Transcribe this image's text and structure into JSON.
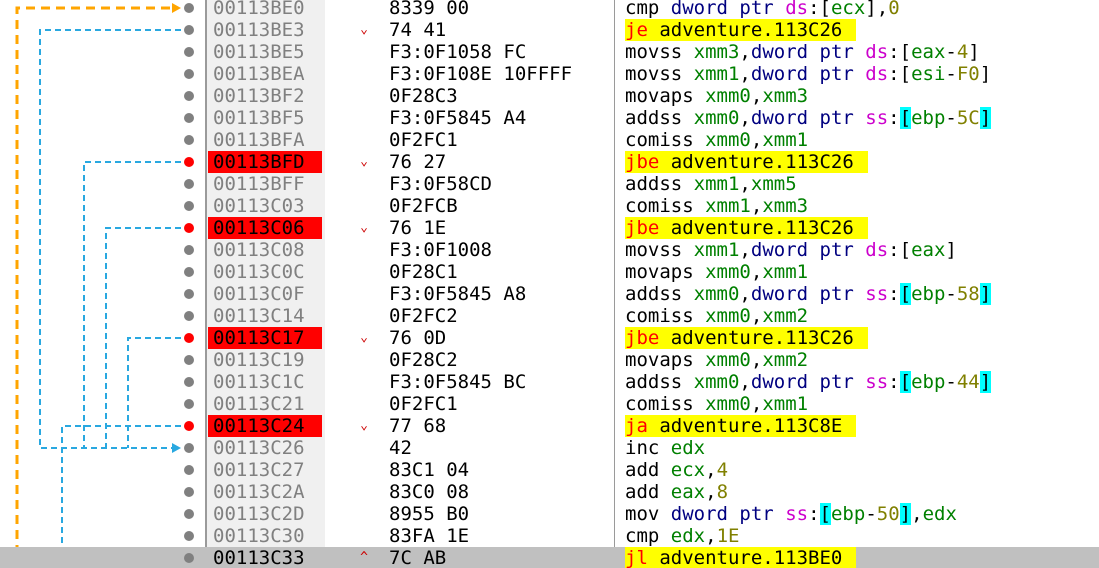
{
  "rows": [
    {
      "addr": "00113BE0",
      "bytes": "8339 00",
      "arrow": "",
      "bp": false,
      "jump": false,
      "tok": [
        [
          "m",
          "cmp"
        ],
        [
          "p",
          " "
        ],
        [
          "k",
          "dword ptr"
        ],
        [
          "p",
          " "
        ],
        [
          "seg",
          "ds"
        ],
        [
          "p",
          ":["
        ],
        [
          "r",
          "ecx"
        ],
        [
          "p",
          "],"
        ],
        [
          "num",
          "0"
        ]
      ]
    },
    {
      "addr": "00113BE3",
      "bytes": "74 41",
      "arrow": "⌄",
      "bp": false,
      "jump": true,
      "tok": [
        [
          "mj",
          "je"
        ],
        [
          "p",
          " "
        ],
        [
          "m",
          "adventure.113C26"
        ]
      ]
    },
    {
      "addr": "00113BE5",
      "bytes": "F3:0F1058 FC",
      "arrow": "",
      "bp": false,
      "jump": false,
      "tok": [
        [
          "m",
          "movss"
        ],
        [
          "p",
          " "
        ],
        [
          "r",
          "xmm3"
        ],
        [
          "p",
          ","
        ],
        [
          "k",
          "dword ptr"
        ],
        [
          "p",
          " "
        ],
        [
          "seg",
          "ds"
        ],
        [
          "p",
          ":["
        ],
        [
          "r",
          "eax"
        ],
        [
          "p",
          "-"
        ],
        [
          "num",
          "4"
        ],
        [
          "p",
          "]"
        ]
      ]
    },
    {
      "addr": "00113BEA",
      "bytes": "F3:0F108E 10FFFF",
      "arrow": "",
      "bp": false,
      "jump": false,
      "tok": [
        [
          "m",
          "movss"
        ],
        [
          "p",
          " "
        ],
        [
          "r",
          "xmm1"
        ],
        [
          "p",
          ","
        ],
        [
          "k",
          "dword ptr"
        ],
        [
          "p",
          " "
        ],
        [
          "seg",
          "ds"
        ],
        [
          "p",
          ":["
        ],
        [
          "r",
          "esi"
        ],
        [
          "p",
          "-"
        ],
        [
          "num",
          "F0"
        ],
        [
          "p",
          "]"
        ]
      ]
    },
    {
      "addr": "00113BF2",
      "bytes": "0F28C3",
      "arrow": "",
      "bp": false,
      "jump": false,
      "tok": [
        [
          "m",
          "movaps"
        ],
        [
          "p",
          " "
        ],
        [
          "r",
          "xmm0"
        ],
        [
          "p",
          ","
        ],
        [
          "r",
          "xmm3"
        ]
      ]
    },
    {
      "addr": "00113BF5",
      "bytes": "F3:0F5845 A4",
      "arrow": "",
      "bp": false,
      "jump": false,
      "tok": [
        [
          "m",
          "addss"
        ],
        [
          "p",
          " "
        ],
        [
          "r",
          "xmm0"
        ],
        [
          "p",
          ","
        ],
        [
          "k",
          "dword ptr"
        ],
        [
          "p",
          " "
        ],
        [
          "seg",
          "ss"
        ],
        [
          "p",
          ":"
        ],
        [
          "bk",
          "["
        ],
        [
          "r",
          "ebp"
        ],
        [
          "p",
          "-"
        ],
        [
          "num",
          "5C"
        ],
        [
          "bk",
          "]"
        ]
      ]
    },
    {
      "addr": "00113BFA",
      "bytes": "0F2FC1",
      "arrow": "",
      "bp": false,
      "jump": false,
      "tok": [
        [
          "m",
          "comiss"
        ],
        [
          "p",
          " "
        ],
        [
          "r",
          "xmm0"
        ],
        [
          "p",
          ","
        ],
        [
          "r",
          "xmm1"
        ]
      ]
    },
    {
      "addr": "00113BFD",
      "bytes": "76 27",
      "arrow": "⌄",
      "bp": true,
      "jump": true,
      "tok": [
        [
          "mj",
          "jbe"
        ],
        [
          "p",
          " "
        ],
        [
          "m",
          "adventure.113C26"
        ]
      ]
    },
    {
      "addr": "00113BFF",
      "bytes": "F3:0F58CD",
      "arrow": "",
      "bp": false,
      "jump": false,
      "tok": [
        [
          "m",
          "addss"
        ],
        [
          "p",
          " "
        ],
        [
          "r",
          "xmm1"
        ],
        [
          "p",
          ","
        ],
        [
          "r",
          "xmm5"
        ]
      ]
    },
    {
      "addr": "00113C03",
      "bytes": "0F2FCB",
      "arrow": "",
      "bp": false,
      "jump": false,
      "tok": [
        [
          "m",
          "comiss"
        ],
        [
          "p",
          " "
        ],
        [
          "r",
          "xmm1"
        ],
        [
          "p",
          ","
        ],
        [
          "r",
          "xmm3"
        ]
      ]
    },
    {
      "addr": "00113C06",
      "bytes": "76 1E",
      "arrow": "⌄",
      "bp": true,
      "jump": true,
      "tok": [
        [
          "mj",
          "jbe"
        ],
        [
          "p",
          " "
        ],
        [
          "m",
          "adventure.113C26"
        ]
      ]
    },
    {
      "addr": "00113C08",
      "bytes": "F3:0F1008",
      "arrow": "",
      "bp": false,
      "jump": false,
      "tok": [
        [
          "m",
          "movss"
        ],
        [
          "p",
          " "
        ],
        [
          "r",
          "xmm1"
        ],
        [
          "p",
          ","
        ],
        [
          "k",
          "dword ptr"
        ],
        [
          "p",
          " "
        ],
        [
          "seg",
          "ds"
        ],
        [
          "p",
          ":["
        ],
        [
          "r",
          "eax"
        ],
        [
          "p",
          "]"
        ]
      ]
    },
    {
      "addr": "00113C0C",
      "bytes": "0F28C1",
      "arrow": "",
      "bp": false,
      "jump": false,
      "tok": [
        [
          "m",
          "movaps"
        ],
        [
          "p",
          " "
        ],
        [
          "r",
          "xmm0"
        ],
        [
          "p",
          ","
        ],
        [
          "r",
          "xmm1"
        ]
      ]
    },
    {
      "addr": "00113C0F",
      "bytes": "F3:0F5845 A8",
      "arrow": "",
      "bp": false,
      "jump": false,
      "tok": [
        [
          "m",
          "addss"
        ],
        [
          "p",
          " "
        ],
        [
          "r",
          "xmm0"
        ],
        [
          "p",
          ","
        ],
        [
          "k",
          "dword ptr"
        ],
        [
          "p",
          " "
        ],
        [
          "seg",
          "ss"
        ],
        [
          "p",
          ":"
        ],
        [
          "bk",
          "["
        ],
        [
          "r",
          "ebp"
        ],
        [
          "p",
          "-"
        ],
        [
          "num",
          "58"
        ],
        [
          "bk",
          "]"
        ]
      ]
    },
    {
      "addr": "00113C14",
      "bytes": "0F2FC2",
      "arrow": "",
      "bp": false,
      "jump": false,
      "tok": [
        [
          "m",
          "comiss"
        ],
        [
          "p",
          " "
        ],
        [
          "r",
          "xmm0"
        ],
        [
          "p",
          ","
        ],
        [
          "r",
          "xmm2"
        ]
      ]
    },
    {
      "addr": "00113C17",
      "bytes": "76 0D",
      "arrow": "⌄",
      "bp": true,
      "jump": true,
      "tok": [
        [
          "mj",
          "jbe"
        ],
        [
          "p",
          " "
        ],
        [
          "m",
          "adventure.113C26"
        ]
      ]
    },
    {
      "addr": "00113C19",
      "bytes": "0F28C2",
      "arrow": "",
      "bp": false,
      "jump": false,
      "tok": [
        [
          "m",
          "movaps"
        ],
        [
          "p",
          " "
        ],
        [
          "r",
          "xmm0"
        ],
        [
          "p",
          ","
        ],
        [
          "r",
          "xmm2"
        ]
      ]
    },
    {
      "addr": "00113C1C",
      "bytes": "F3:0F5845 BC",
      "arrow": "",
      "bp": false,
      "jump": false,
      "tok": [
        [
          "m",
          "addss"
        ],
        [
          "p",
          " "
        ],
        [
          "r",
          "xmm0"
        ],
        [
          "p",
          ","
        ],
        [
          "k",
          "dword ptr"
        ],
        [
          "p",
          " "
        ],
        [
          "seg",
          "ss"
        ],
        [
          "p",
          ":"
        ],
        [
          "bk",
          "["
        ],
        [
          "r",
          "ebp"
        ],
        [
          "p",
          "-"
        ],
        [
          "num",
          "44"
        ],
        [
          "bk",
          "]"
        ]
      ]
    },
    {
      "addr": "00113C21",
      "bytes": "0F2FC1",
      "arrow": "",
      "bp": false,
      "jump": false,
      "tok": [
        [
          "m",
          "comiss"
        ],
        [
          "p",
          " "
        ],
        [
          "r",
          "xmm0"
        ],
        [
          "p",
          ","
        ],
        [
          "r",
          "xmm1"
        ]
      ]
    },
    {
      "addr": "00113C24",
      "bytes": "77 68",
      "arrow": "⌄",
      "bp": true,
      "jump": true,
      "tok": [
        [
          "mj",
          "ja"
        ],
        [
          "p",
          " "
        ],
        [
          "m",
          "adventure.113C8E"
        ]
      ]
    },
    {
      "addr": "00113C26",
      "bytes": "42",
      "arrow": "",
      "bp": false,
      "jump": false,
      "tok": [
        [
          "m",
          "inc"
        ],
        [
          "p",
          " "
        ],
        [
          "r",
          "edx"
        ]
      ]
    },
    {
      "addr": "00113C27",
      "bytes": "83C1 04",
      "arrow": "",
      "bp": false,
      "jump": false,
      "tok": [
        [
          "m",
          "add"
        ],
        [
          "p",
          " "
        ],
        [
          "r",
          "ecx"
        ],
        [
          "p",
          ","
        ],
        [
          "num",
          "4"
        ]
      ]
    },
    {
      "addr": "00113C2A",
      "bytes": "83C0 08",
      "arrow": "",
      "bp": false,
      "jump": false,
      "tok": [
        [
          "m",
          "add"
        ],
        [
          "p",
          " "
        ],
        [
          "r",
          "eax"
        ],
        [
          "p",
          ","
        ],
        [
          "num",
          "8"
        ]
      ]
    },
    {
      "addr": "00113C2D",
      "bytes": "8955 B0",
      "arrow": "",
      "bp": false,
      "jump": false,
      "tok": [
        [
          "m",
          "mov"
        ],
        [
          "p",
          " "
        ],
        [
          "k",
          "dword ptr"
        ],
        [
          "p",
          " "
        ],
        [
          "seg",
          "ss"
        ],
        [
          "p",
          ":"
        ],
        [
          "bk",
          "["
        ],
        [
          "r",
          "ebp"
        ],
        [
          "p",
          "-"
        ],
        [
          "num",
          "50"
        ],
        [
          "bk",
          "]"
        ],
        [
          "p",
          ","
        ],
        [
          "r",
          "edx"
        ]
      ]
    },
    {
      "addr": "00113C30",
      "bytes": "83FA 1E",
      "arrow": "",
      "bp": false,
      "jump": false,
      "tok": [
        [
          "m",
          "cmp"
        ],
        [
          "p",
          " "
        ],
        [
          "r",
          "edx"
        ],
        [
          "p",
          ","
        ],
        [
          "num",
          "1E"
        ]
      ]
    },
    {
      "addr": "00113C33",
      "bytes": "7C AB",
      "arrow": "^",
      "bp": false,
      "jump": true,
      "current": true,
      "tok": [
        [
          "mj",
          "jl"
        ],
        [
          "p",
          " "
        ],
        [
          "m",
          "adventure.113BE0"
        ]
      ]
    }
  ],
  "colors": {
    "breakpoint": "#ff0000",
    "jump_highlight": "#ffff00",
    "loop_arrow": "#ffa500",
    "branch_arrow": "#29a8e0",
    "current_row": "#c0c0c0"
  }
}
